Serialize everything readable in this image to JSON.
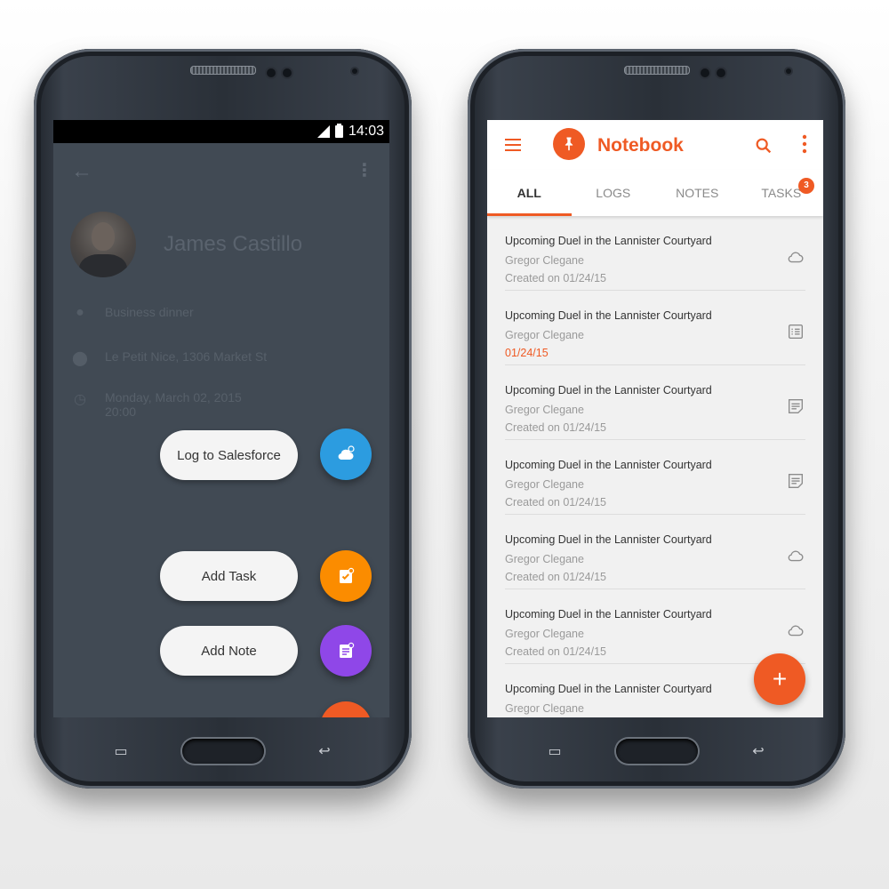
{
  "left_phone": {
    "status": {
      "time": "14:03"
    },
    "contact": {
      "name": "James Castillo",
      "details": [
        {
          "icon": "chat-bubble-icon",
          "lines": [
            "Business dinner"
          ]
        },
        {
          "icon": "location-pin-icon",
          "lines": [
            "Le Petit Nice, 1306 Market St"
          ]
        },
        {
          "icon": "timer-icon",
          "lines": [
            "Monday, March 02, 2015",
            "20:00"
          ]
        }
      ]
    },
    "actions": [
      {
        "label": "Log to Salesforce",
        "icon": "cloud-icon",
        "color": "#2c9ce0"
      },
      {
        "label": "Add Task",
        "icon": "task-icon",
        "color": "#fb8c00"
      },
      {
        "label": "Add Note",
        "icon": "note-icon",
        "color": "#8f47e8"
      }
    ],
    "close_fab": {
      "label": "×",
      "color": "#ef5a24"
    }
  },
  "right_phone": {
    "app_title": "Notebook",
    "accent_color": "#ef5a24",
    "tabs": [
      {
        "label": "ALL",
        "active": true
      },
      {
        "label": "LOGS",
        "active": false
      },
      {
        "label": "NOTES",
        "active": false
      },
      {
        "label": "TASKS",
        "active": false,
        "badge": "3"
      }
    ],
    "items": [
      {
        "title": "Upcoming Duel in the Lannister Courtyard",
        "person": "Gregor Clegane",
        "date": "Created on 01/24/15",
        "icon": "cloud-icon",
        "due": false
      },
      {
        "title": "Upcoming Duel in the Lannister Courtyard",
        "person": "Gregor Clegane",
        "date": "01/24/15",
        "icon": "task-list-icon",
        "due": true
      },
      {
        "title": "Upcoming Duel in the Lannister Courtyard",
        "person": "Gregor Clegane",
        "date": "Created on 01/24/15",
        "icon": "note-icon",
        "due": false
      },
      {
        "title": "Upcoming Duel in the Lannister Courtyard",
        "person": "Gregor Clegane",
        "date": "Created on 01/24/15",
        "icon": "note-icon",
        "due": false
      },
      {
        "title": "Upcoming Duel in the Lannister Courtyard",
        "person": "Gregor Clegane",
        "date": "Created on 01/24/15",
        "icon": "cloud-icon",
        "due": false
      },
      {
        "title": "Upcoming Duel in the Lannister Courtyard",
        "person": "Gregor Clegane",
        "date": "Created on 01/24/15",
        "icon": "cloud-icon",
        "due": false
      },
      {
        "title": "Upcoming Duel in the Lannister Courtyard",
        "person": "Gregor Clegane",
        "date": "",
        "icon": "",
        "due": false
      }
    ],
    "add_fab": {
      "label": "+"
    }
  }
}
